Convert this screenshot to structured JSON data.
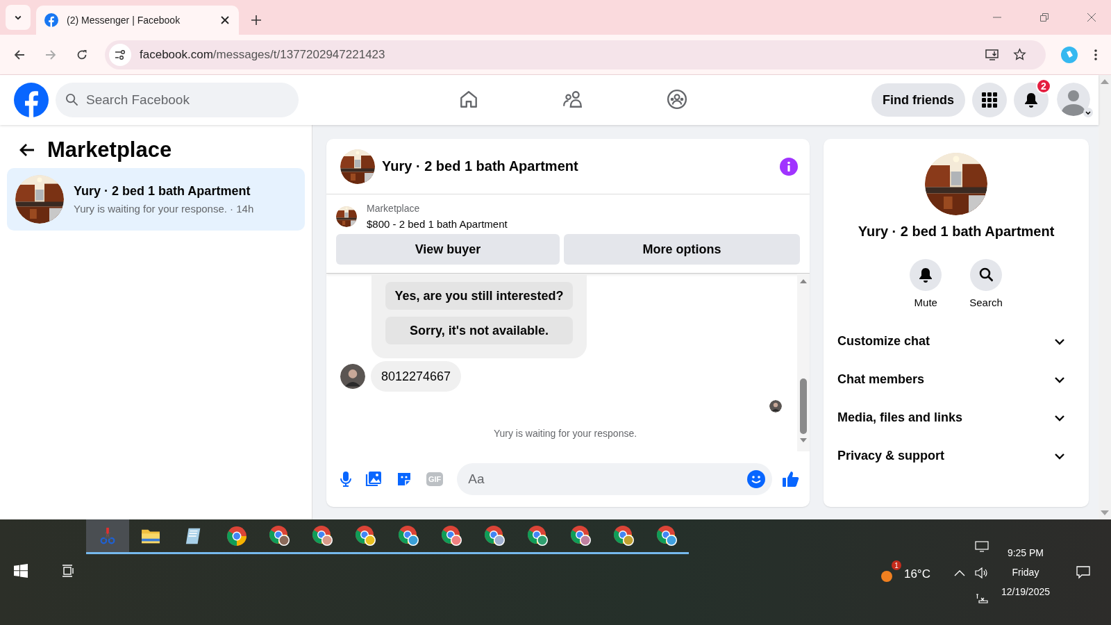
{
  "browser": {
    "tab_title": "(2) Messenger | Facebook",
    "url_domain": "facebook.com",
    "url_path": "/messages/t/1377202947221423"
  },
  "header": {
    "search_placeholder": "Search Facebook",
    "nav": [
      {
        "kind": "home",
        "selected": false
      },
      {
        "kind": "friends",
        "selected": false
      },
      {
        "kind": "groups",
        "selected": false
      }
    ],
    "find_friends": "Find friends",
    "notification_count": "2"
  },
  "sidebar": {
    "title": "Marketplace",
    "conversations": [
      {
        "name": "Yury · 2 bed 1 bath Apartment",
        "preview": "Yury is waiting for your response. · 14h",
        "selected": true
      }
    ]
  },
  "chat": {
    "title": "Yury · 2 bed 1 bath Apartment",
    "listing_source": "Marketplace",
    "listing": "$800 - 2 bed 1 bath Apartment",
    "buttons": [
      "View buyer",
      "More options"
    ],
    "quick_replies": [
      "Yes, are you still interested?",
      "Sorry, it's not available."
    ],
    "message": "8012274667",
    "notice": "Yury is waiting for your response.",
    "composer_placeholder": "Aa",
    "gif_label": "GIF"
  },
  "details": {
    "title": "Yury · 2 bed 1 bath Apartment",
    "actions": [
      {
        "kind": "mute",
        "label": "Mute"
      },
      {
        "kind": "search",
        "label": "Search"
      }
    ],
    "sections": [
      {
        "label": "Customize chat",
        "expanded": false
      },
      {
        "label": "Chat members",
        "expanded": false
      },
      {
        "label": "Media, files and links",
        "expanded": false
      },
      {
        "label": "Privacy & support",
        "expanded": false
      }
    ]
  },
  "taskbar": {
    "apps": [
      {
        "kind": "snip",
        "selected": true
      },
      {
        "kind": "folder",
        "selected": false
      },
      {
        "kind": "notepad",
        "selected": false
      },
      {
        "kind": "chrome",
        "selected": false
      },
      {
        "kind": "chrome-profile",
        "color": "#8a6a5a",
        "selected": false
      },
      {
        "kind": "chrome-profile",
        "color": "#d89a8a",
        "selected": false
      },
      {
        "kind": "chrome-profile",
        "color": "#e8c020",
        "selected": false
      },
      {
        "kind": "chrome-profile",
        "color": "#3aa0d8",
        "selected": false
      },
      {
        "kind": "chrome-profile",
        "color": "#f08080",
        "selected": false
      },
      {
        "kind": "chrome-profile",
        "color": "#a0b0d0",
        "selected": false
      },
      {
        "kind": "chrome-profile",
        "color": "#30a070",
        "selected": false
      },
      {
        "kind": "chrome-profile",
        "color": "#c080a0",
        "selected": false
      },
      {
        "kind": "chrome-profile",
        "color": "#c0a030",
        "selected": false
      },
      {
        "kind": "chrome-profile",
        "color": "#40a0e0",
        "selected": false
      }
    ],
    "weather_badge": "1",
    "temperature": "16°C",
    "time": "9:25 PM",
    "day": "Friday",
    "date": "12/19/2025"
  }
}
